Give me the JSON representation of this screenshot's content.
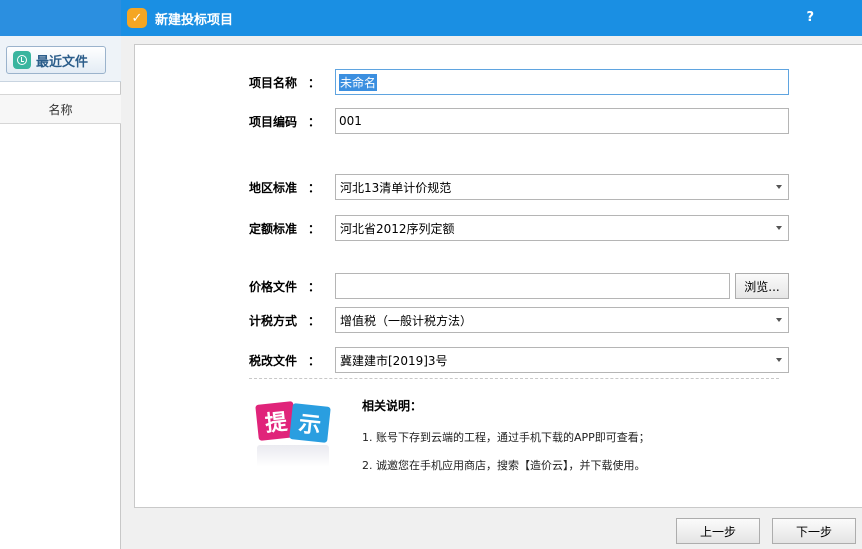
{
  "background_app": {
    "recent_files_label": "最近文件",
    "column_name": "名称"
  },
  "dialog": {
    "title": "新建投标项目",
    "help": "?",
    "close": "×",
    "logo_glyph": "✓"
  },
  "form": {
    "project_name": {
      "label": "项目名称",
      "colon": "：",
      "value": "未命名"
    },
    "project_code": {
      "label": "项目编码",
      "colon": "：",
      "value": "001"
    },
    "region_standard": {
      "label": "地区标准",
      "colon": "：",
      "value": "河北13清单计价规范"
    },
    "quota_standard": {
      "label": "定额标准",
      "colon": "：",
      "value": "河北省2012序列定额"
    },
    "price_file": {
      "label": "价格文件",
      "colon": "：",
      "value": "",
      "browse_label": "浏览..."
    },
    "tax_method": {
      "label": "计税方式",
      "colon": "：",
      "value": "增值税（一般计税方法）"
    },
    "tax_reform_file": {
      "label": "税改文件",
      "colon": "：",
      "value": "冀建建市[2019]3号"
    }
  },
  "tips": {
    "icon_text_1": "提",
    "icon_text_2": "示",
    "title": "相关说明：",
    "items": [
      "1. 账号下存到云端的工程，通过手机下载的APP即可查看；",
      "2. 诚邀您在手机应用商店，搜索【造价云】，并下载使用。"
    ]
  },
  "footer": {
    "prev_label": "上一步",
    "next_label": "下一步"
  },
  "colors": {
    "title_bar": "#1a8fe3",
    "accent_pink": "#e0247a",
    "accent_blue": "#2a9ee0",
    "selection": "#3b8fe0"
  }
}
